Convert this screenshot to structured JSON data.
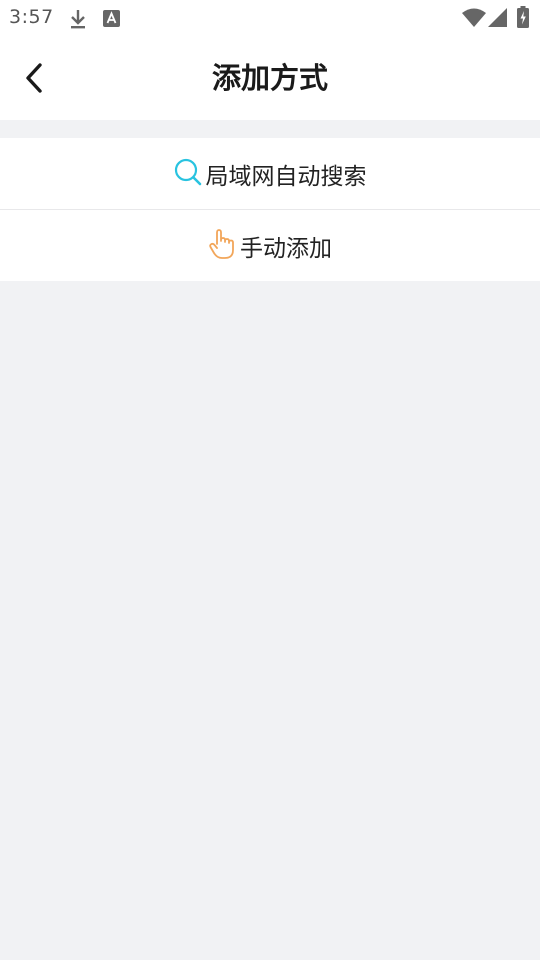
{
  "status_bar": {
    "time": "3:57",
    "icons": [
      "download-icon",
      "a-notification-icon",
      "wifi-icon",
      "signal-icon",
      "battery-charging-icon"
    ]
  },
  "header": {
    "title": "添加方式",
    "back_icon": "back-arrow-icon"
  },
  "options": [
    {
      "label": "局域网自动搜索",
      "icon": "search-icon",
      "icon_color": "#29c3e0"
    },
    {
      "label": "手动添加",
      "icon": "hand-pointer-icon",
      "icon_color": "#f2a65a"
    }
  ],
  "colors": {
    "background": "#f1f2f4",
    "surface": "#ffffff",
    "text": "#222222"
  }
}
